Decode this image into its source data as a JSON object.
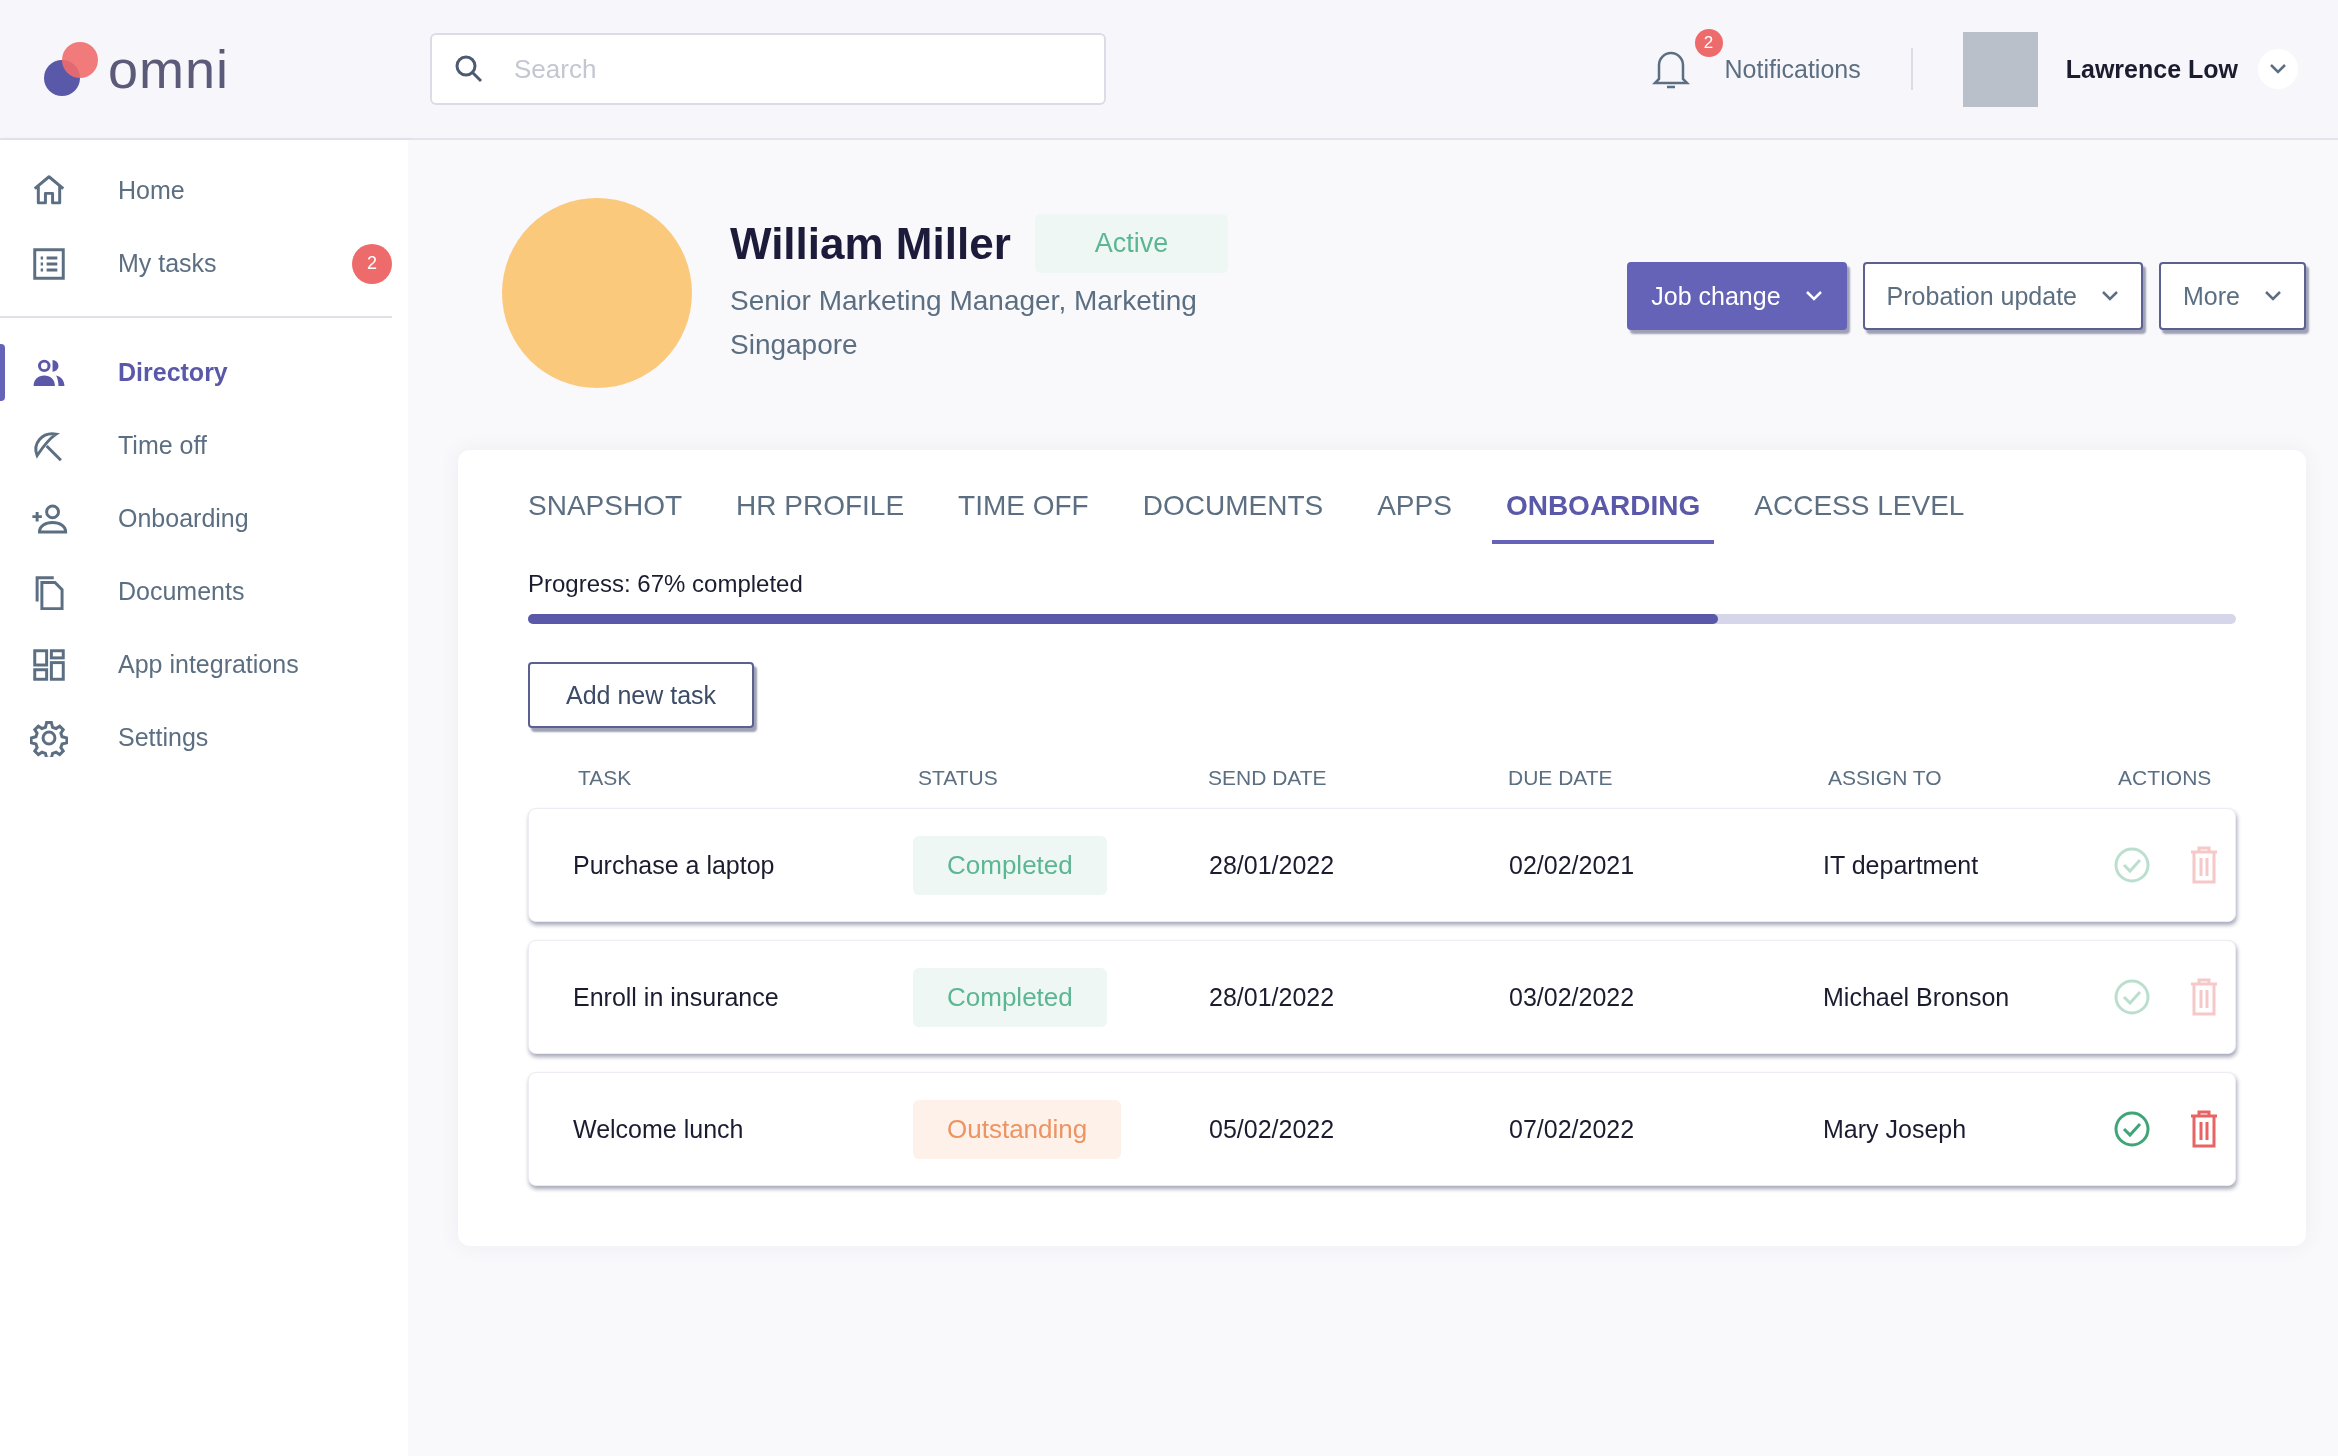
{
  "header": {
    "logo": "omni",
    "search": {
      "placeholder": "Search"
    },
    "notifications": {
      "label": "Notifications",
      "count": "2"
    },
    "user": {
      "name": "Lawrence Low"
    }
  },
  "sidebar": {
    "items": [
      {
        "label": "Home",
        "selected": false
      },
      {
        "label": "My tasks",
        "selected": false,
        "badge": "2"
      },
      {
        "label": "Directory",
        "selected": true
      },
      {
        "label": "Time off",
        "selected": false
      },
      {
        "label": "Onboarding",
        "selected": false
      },
      {
        "label": "Documents",
        "selected": false
      },
      {
        "label": "App integrations",
        "selected": false
      },
      {
        "label": "Settings",
        "selected": false
      }
    ]
  },
  "profile": {
    "name": "William Miller",
    "status": "Active",
    "title": "Senior Marketing Manager, Marketing",
    "location": "Singapore",
    "actions": [
      {
        "label": "Job change",
        "kind": "primary"
      },
      {
        "label": "Probation update",
        "kind": "outline"
      },
      {
        "label": "More",
        "kind": "outline"
      }
    ]
  },
  "tabs": [
    {
      "label": "SNAPSHOT",
      "selected": false
    },
    {
      "label": "HR PROFILE",
      "selected": false
    },
    {
      "label": "TIME OFF",
      "selected": false
    },
    {
      "label": "DOCUMENTS",
      "selected": false
    },
    {
      "label": "APPS",
      "selected": false
    },
    {
      "label": "ONBOARDING",
      "selected": true
    },
    {
      "label": "ACCESS LEVEL",
      "selected": false
    }
  ],
  "progress": {
    "label": "Progress: 67% completed",
    "level": 0.697
  },
  "add_button": "Add new task",
  "table": {
    "columns": [
      "TASK",
      "STATUS",
      "SEND DATE",
      "DUE DATE",
      "ASSIGN TO",
      "ACTIONS"
    ],
    "rows": [
      {
        "task": "Purchase a laptop",
        "status": "Completed",
        "kind": "completed",
        "send_date": "28/01/2022",
        "due_date": "02/02/2021",
        "assign_to": "IT department",
        "actions_disabled": true
      },
      {
        "task": "Enroll in insurance",
        "status": "Completed",
        "kind": "completed",
        "send_date": "28/01/2022",
        "due_date": "03/02/2022",
        "assign_to": "Michael Bronson",
        "actions_disabled": true
      },
      {
        "task": "Welcome lunch",
        "status": "Outstanding",
        "kind": "outstanding",
        "send_date": "05/02/2022",
        "due_date": "07/02/2022",
        "assign_to": "Mary Joseph",
        "actions_disabled": false
      }
    ]
  }
}
